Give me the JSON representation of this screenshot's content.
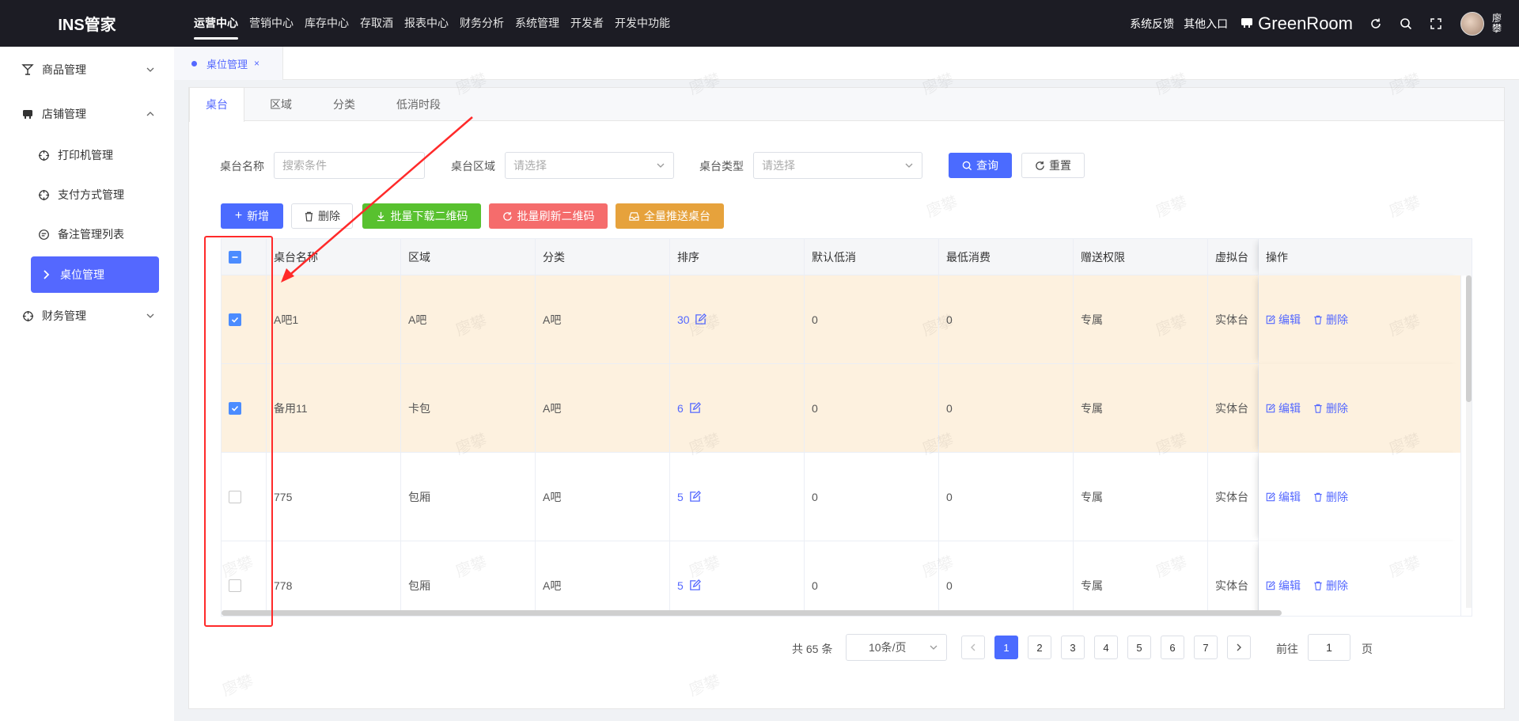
{
  "brand": "INS管家",
  "topnav": [
    "运营中心",
    "营销中心",
    "库存中心",
    "存取酒",
    "报表中心",
    "财务分析",
    "系统管理",
    "开发者",
    "开发中功能"
  ],
  "topright": {
    "feedback": "系统反馈",
    "other": "其他入口",
    "store": "GreenRoom",
    "user": "廖攀"
  },
  "sidebar": {
    "goods": "商品管理",
    "shop": "店铺管理",
    "printer": "打印机管理",
    "payment": "支付方式管理",
    "remarks": "备注管理列表",
    "tables": "桌位管理",
    "finance": "财务管理"
  },
  "page_tab": {
    "label": "桌位管理",
    "close": "×"
  },
  "subtabs": [
    "桌台",
    "区域",
    "分类",
    "低消时段"
  ],
  "filter": {
    "name_label": "桌台名称",
    "name_placeholder": "搜索条件",
    "area_label": "桌台区域",
    "area_placeholder": "请选择",
    "type_label": "桌台类型",
    "type_placeholder": "请选择",
    "query": "查询",
    "reset": "重置"
  },
  "actions": {
    "add": "新增",
    "delete": "删除",
    "batch_download": "批量下载二维码",
    "batch_refresh": "批量刷新二维码",
    "push_all": "全量推送桌台"
  },
  "table": {
    "headers": [
      "桌台名称",
      "区域",
      "分类",
      "排序",
      "默认低消",
      "最低消费",
      "赠送权限",
      "虚拟台",
      "操作"
    ],
    "rows": [
      {
        "name": "A吧1",
        "area": "A吧",
        "category": "A吧",
        "sort": "30",
        "default_min": "0",
        "min_spend": "0",
        "gift": "专属",
        "virtual": "实体台",
        "checked": true
      },
      {
        "name": "备用11",
        "area": "卡包",
        "category": "A吧",
        "sort": "6",
        "default_min": "0",
        "min_spend": "0",
        "gift": "专属",
        "virtual": "实体台",
        "checked": true
      },
      {
        "name": "775",
        "area": "包厢",
        "category": "A吧",
        "sort": "5",
        "default_min": "0",
        "min_spend": "0",
        "gift": "专属",
        "virtual": "实体台",
        "checked": false
      },
      {
        "name": "778",
        "area": "包厢",
        "category": "A吧",
        "sort": "5",
        "default_min": "0",
        "min_spend": "0",
        "gift": "专属",
        "virtual": "实体台",
        "checked": false
      }
    ],
    "edit": "编辑",
    "delete": "删除"
  },
  "pagination": {
    "total": "共 65 条",
    "page_size": "10条/页",
    "pages": [
      "1",
      "2",
      "3",
      "4",
      "5",
      "6",
      "7"
    ],
    "current": "1",
    "goto_label": "前往",
    "goto_value": "1",
    "page_suffix": "页"
  },
  "watermark": "廖攀",
  "colors": {
    "accent": "#5468ff",
    "topbar": "#1c1c24",
    "selected_row": "#fdf1df",
    "annotation": "#ff2a2a"
  }
}
